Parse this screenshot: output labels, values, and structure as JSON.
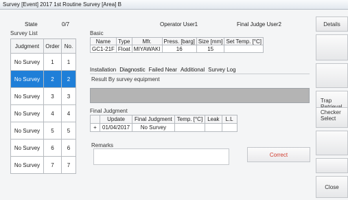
{
  "window": {
    "title": "Survey  [Event] 2017 1st Routine Survey  [Area] B"
  },
  "header": {
    "state_label": "State",
    "state_value": "0/7",
    "operator": "Operator User1",
    "final_judge": "Final Judge User2"
  },
  "survey_list": {
    "label": "Survey List",
    "columns": [
      "Judgment",
      "Order",
      "No."
    ],
    "rows": [
      [
        "No Survey",
        "1",
        "1"
      ],
      [
        "No Survey",
        "2",
        "2"
      ],
      [
        "No Survey",
        "3",
        "3"
      ],
      [
        "No Survey",
        "4",
        "4"
      ],
      [
        "No Survey",
        "5",
        "5"
      ],
      [
        "No Survey",
        "6",
        "6"
      ],
      [
        "No Survey",
        "7",
        "7"
      ]
    ],
    "selected_index": 1
  },
  "basic": {
    "label": "Basic",
    "columns": [
      "Name",
      "Type",
      "Mfr.",
      "Press. [barg]",
      "Size [mm]",
      "Set Temp. [°C]"
    ],
    "row": [
      "GC1-21F",
      "Float",
      "MIYAWAKI",
      "16",
      "15",
      ""
    ]
  },
  "tabs": [
    "Installation",
    "Diagnostic",
    "Failed Near",
    "Additional",
    "Survey Log"
  ],
  "active_tab": "Diagnostic",
  "diagnostic": {
    "result_label": "Result By survey equipment"
  },
  "final_judgment": {
    "label": "Final Judgment",
    "columns": [
      "Update",
      "Final Judgment",
      "Temp. [°C]",
      "Leak",
      "L.L"
    ],
    "row": [
      "01/04/2017",
      "No Survey",
      "",
      "",
      ""
    ],
    "row_marker": "+"
  },
  "remarks": {
    "label": "Remarks",
    "value": ""
  },
  "buttons": {
    "correct": "Correct",
    "details": "Details",
    "trap_retrieval_1": "Trap",
    "trap_retrieval_2": "Retrieval",
    "checker_select_1": "Checker",
    "checker_select_2": "Select",
    "close": "Close"
  },
  "colors": {
    "selected_row": "#1f7fd8",
    "correct_text": "#d0392b"
  }
}
